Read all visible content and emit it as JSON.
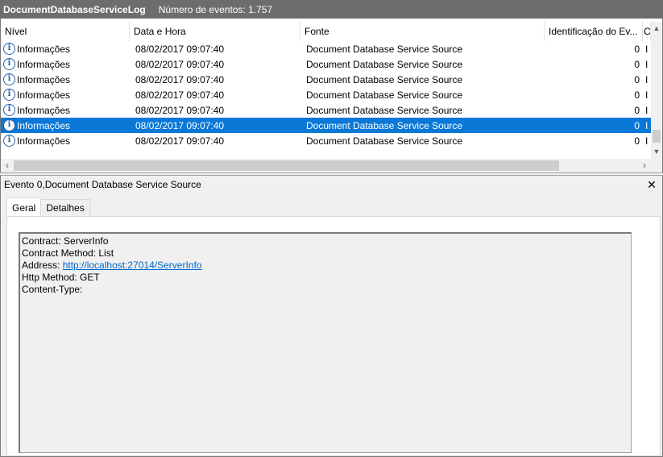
{
  "titlebar": {
    "log_name": "DocumentDatabaseServiceLog",
    "event_count": "Número de eventos: 1.757"
  },
  "columns": [
    "Nível",
    "Data e Hora",
    "Fonte",
    "Identificação do Ev...",
    "C"
  ],
  "rows": [
    {
      "level": "Informações",
      "date": "08/02/2017 09:07:40",
      "source": "Document Database Service Source",
      "id": "0",
      "extra": "I",
      "selected": false
    },
    {
      "level": "Informações",
      "date": "08/02/2017 09:07:40",
      "source": "Document Database Service Source",
      "id": "0",
      "extra": "I",
      "selected": false
    },
    {
      "level": "Informações",
      "date": "08/02/2017 09:07:40",
      "source": "Document Database Service Source",
      "id": "0",
      "extra": "I",
      "selected": false
    },
    {
      "level": "Informações",
      "date": "08/02/2017 09:07:40",
      "source": "Document Database Service Source",
      "id": "0",
      "extra": "I",
      "selected": false
    },
    {
      "level": "Informações",
      "date": "08/02/2017 09:07:40",
      "source": "Document Database Service Source",
      "id": "0",
      "extra": "I",
      "selected": false
    },
    {
      "level": "Informações",
      "date": "08/02/2017 09:07:40",
      "source": "Document Database Service Source",
      "id": "0",
      "extra": "I",
      "selected": true
    },
    {
      "level": "Informações",
      "date": "08/02/2017 09:07:40",
      "source": "Document Database Service Source",
      "id": "0",
      "extra": "I",
      "selected": false
    }
  ],
  "icons": {
    "level": "info-icon",
    "close": "close-icon",
    "scroll_up": "chevron-up-icon",
    "scroll_down": "chevron-down-icon",
    "scroll_left": "chevron-left-icon",
    "scroll_right": "chevron-right-icon"
  },
  "glyphs": {
    "info": "i",
    "close": "✕",
    "up": "▲",
    "down": "▼",
    "left": "‹",
    "right": "›"
  },
  "detail": {
    "header": "Evento 0,Document Database Service Source",
    "tabs": [
      "Geral",
      "Detalhes"
    ],
    "active_tab": "Geral",
    "lines": [
      {
        "text": "Contract: ServerInfo"
      },
      {
        "text": "Contract Method: List"
      },
      {
        "prefix": "Address: ",
        "link": "http://localhost:27014/ServerInfo"
      },
      {
        "text": "Http Method: GET"
      },
      {
        "text": "Content-Type:"
      }
    ]
  },
  "colors": {
    "titlebar_bg": "#6d6d6d",
    "selection": "#0a78d7",
    "link": "#0066cc",
    "panel_bg": "#f0f0f0"
  }
}
